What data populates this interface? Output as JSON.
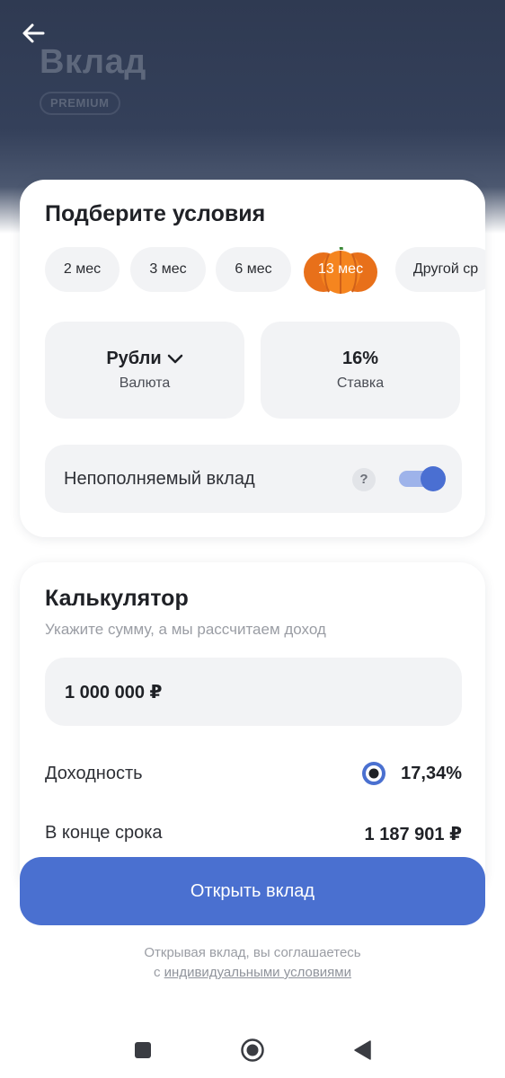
{
  "header": {
    "title": "Вклад",
    "badge": "PREMIUM",
    "back_icon": "arrow-left-icon"
  },
  "conditions": {
    "title": "Подберите условия",
    "terms": [
      {
        "label": "2 мес",
        "selected": false
      },
      {
        "label": "3 мес",
        "selected": false
      },
      {
        "label": "6 мес",
        "selected": false
      },
      {
        "label": "13 мес",
        "selected": true,
        "icon": "pumpkin-icon"
      },
      {
        "label": "Другой ср",
        "selected": false
      }
    ],
    "currency": {
      "value": "Рубли",
      "label": "Валюта"
    },
    "rate": {
      "value": "16%",
      "label": "Ставка"
    },
    "non_replenishable": {
      "label": "Непополняемый вклад",
      "help": "?",
      "enabled": true
    }
  },
  "calculator": {
    "title": "Калькулятор",
    "subtitle": "Укажите сумму, а мы рассчитаем доход",
    "amount": "1 000 000 ₽",
    "yield_label": "Доходность",
    "yield_value": "17,34%",
    "end_label": "В конце срока",
    "end_value": "1 187 901 ₽"
  },
  "actions": {
    "open_button": "Открыть вклад",
    "agreement_text": "Открывая вклад, вы соглашаетесь",
    "agreement_prefix": "с ",
    "agreement_link": "индивидуальными условиями"
  },
  "navbar": {
    "icons": [
      "recents-square-icon",
      "home-circle-icon",
      "back-triangle-icon"
    ]
  },
  "colors": {
    "accent": "#4a70d0",
    "header_bg": "#2f3a52",
    "tile_bg": "#f2f3f5",
    "pumpkin": "#f07a1c"
  }
}
